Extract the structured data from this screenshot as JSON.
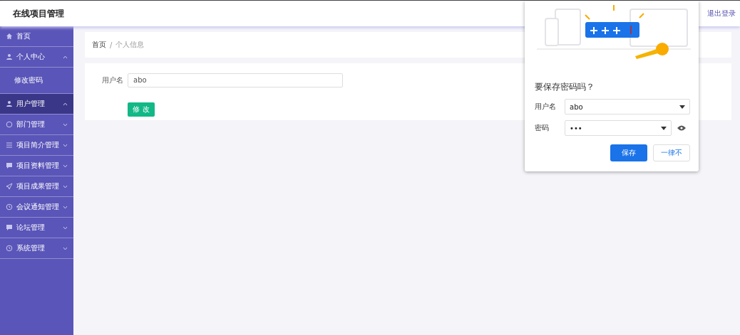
{
  "header": {
    "title": "在线项目管理",
    "logout": "退出登录"
  },
  "sidebar": {
    "items": [
      {
        "label": "首页",
        "kind": "link",
        "selected": false
      },
      {
        "label": "个人中心",
        "kind": "menu",
        "selected": false,
        "expanded": true,
        "children": [
          {
            "label": "修改密码",
            "selected": false
          }
        ]
      },
      {
        "label": "用户管理",
        "kind": "menu",
        "selected": true,
        "expanded": true
      },
      {
        "label": "部门管理",
        "kind": "menu",
        "selected": false,
        "expanded": false
      },
      {
        "label": "项目简介管理",
        "kind": "menu",
        "selected": false,
        "expanded": false
      },
      {
        "label": "项目资料管理",
        "kind": "menu",
        "selected": false,
        "expanded": false
      },
      {
        "label": "项目成果管理",
        "kind": "menu",
        "selected": false,
        "expanded": false
      },
      {
        "label": "会议通知管理",
        "kind": "menu",
        "selected": false,
        "expanded": false
      },
      {
        "label": "论坛管理",
        "kind": "menu",
        "selected": false,
        "expanded": false
      },
      {
        "label": "系统管理",
        "kind": "menu",
        "selected": false,
        "expanded": false
      }
    ]
  },
  "breadcrumb": [
    "首页",
    "个人信息"
  ],
  "breadcrumb_separator": "/",
  "form": {
    "label": "用户名",
    "value": "abo",
    "submit": "修 改"
  },
  "save_password_dialog": {
    "title": "要保存密码吗？",
    "username_label": "用户名",
    "username_value": "abo",
    "password_label": "密码",
    "password_value": "•••",
    "save": "保存",
    "never": "一律不"
  }
}
